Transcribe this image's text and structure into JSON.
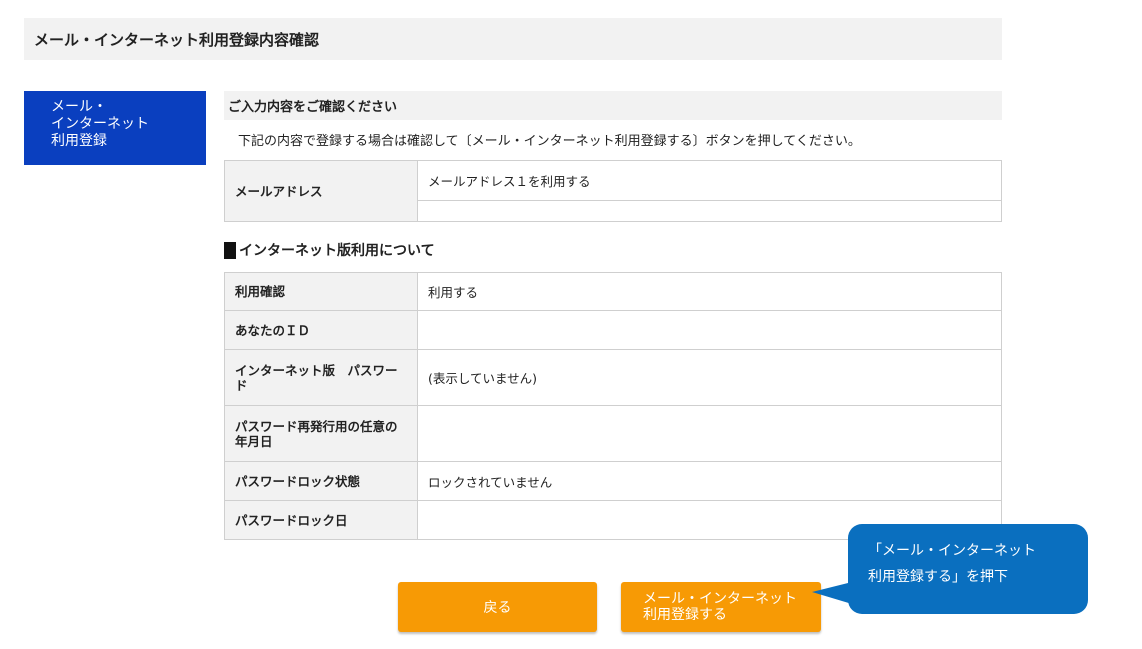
{
  "page": {
    "title": "メール・インターネット利用登録内容確認"
  },
  "sidebar": {
    "lines": [
      "メール・",
      "インターネット",
      "利用登録"
    ]
  },
  "confirm": {
    "heading": "ご入力内容をご確認ください",
    "instruction": "下記の内容で登録する場合は確認して〔メール・インターネット利用登録する〕ボタンを押してください。",
    "mail": {
      "label": "メールアドレス",
      "value": "メールアドレス１を利用する",
      "value2": ""
    }
  },
  "internet": {
    "heading": "インターネット版利用について",
    "rows": [
      {
        "label": "利用確認",
        "value": "利用する"
      },
      {
        "label": "あなたのＩＤ",
        "value": ""
      },
      {
        "label": "インターネット版　パスワード",
        "value": "(表示していません)"
      },
      {
        "label": "パスワード再発行用の任意の年月日",
        "value": ""
      },
      {
        "label": "パスワードロック状態",
        "value": "ロックされていません"
      },
      {
        "label": "パスワードロック日",
        "value": ""
      }
    ]
  },
  "buttons": {
    "back": "戻る",
    "register_lines": [
      "メール・インターネット",
      "利用登録する"
    ]
  },
  "callout": {
    "lines": [
      "「メール・インターネット",
      "利用登録する」を押下"
    ]
  },
  "colors": {
    "nav_blue": "#0a3fbf",
    "button_orange": "#f79a05",
    "callout_blue": "#0a6fbf",
    "header_gray": "#f2f2f2"
  }
}
